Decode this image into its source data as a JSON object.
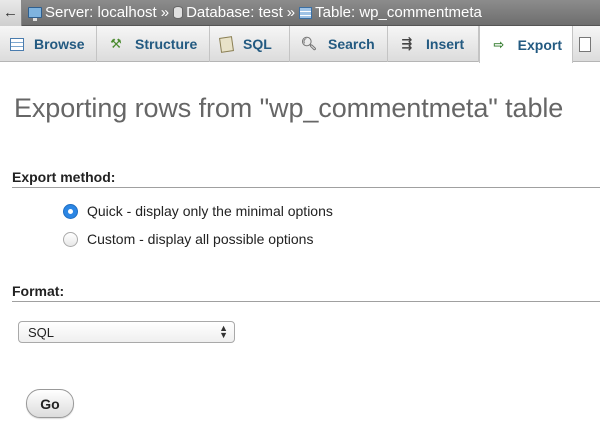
{
  "breadcrumb": {
    "back_glyph": "←",
    "server": "Server: localhost",
    "database": "Database: test",
    "table": "Table: wp_commentmeta",
    "separator": "»"
  },
  "tabs": [
    {
      "label": "Browse",
      "icon": "browse-icon"
    },
    {
      "label": "Structure",
      "icon": "structure-icon"
    },
    {
      "label": "SQL",
      "icon": "sql-icon"
    },
    {
      "label": "Search",
      "icon": "search-icon"
    },
    {
      "label": "Insert",
      "icon": "insert-icon"
    },
    {
      "label": "Export",
      "icon": "export-icon",
      "active": true
    },
    {
      "label": "",
      "icon": "import-icon"
    }
  ],
  "page": {
    "title": "Exporting rows from \"wp_commentmeta\" table"
  },
  "export_method": {
    "heading": "Export method:",
    "options": [
      {
        "label": "Quick - display only the minimal options",
        "checked": true
      },
      {
        "label": "Custom - display all possible options",
        "checked": false
      }
    ]
  },
  "format": {
    "heading": "Format:",
    "selected": "SQL"
  },
  "actions": {
    "go_label": "Go"
  },
  "colors": {
    "tab_text": "#235a81",
    "radio_checked": "#2b86e4",
    "title_text": "#666666"
  }
}
